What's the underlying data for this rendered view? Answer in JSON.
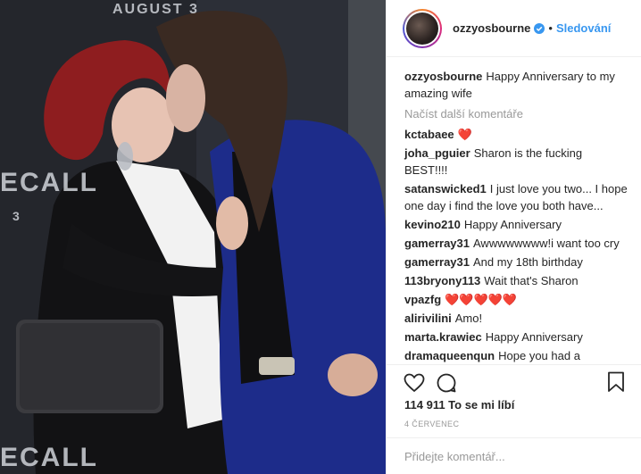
{
  "photo": {
    "backdrop_texts": [
      "AUGUST 3",
      "ECALL",
      "3",
      "ECALL"
    ],
    "image_alt": "couple kissing at premiere"
  },
  "header": {
    "username": "ozzyosbourne",
    "follow_label": "Sledování",
    "separator": "•"
  },
  "caption": {
    "user": "ozzyosbourne",
    "text": "Happy Anniversary to my amazing wife"
  },
  "load_more_label": "Načíst další komentáře",
  "comments": [
    {
      "user": "kctabaee",
      "text": "❤️"
    },
    {
      "user": "joha_pguier",
      "text": "Sharon is the fucking BEST!!!!"
    },
    {
      "user": "satanswicked1",
      "text": "I just love you two... I hope one day i find the love you both have..."
    },
    {
      "user": "kevino210",
      "text": "Happy Anniversary"
    },
    {
      "user": "gamerray31",
      "text": "Awwwwwwww!i want too cry"
    },
    {
      "user": "gamerray31",
      "text": "And my 18th birthday"
    },
    {
      "user": "113bryony113",
      "text": "Wait that's Sharon"
    },
    {
      "user": "vpazfg",
      "text": "❤️❤️❤️❤️❤️"
    },
    {
      "user": "alirivilini",
      "text": "Amo!"
    },
    {
      "user": "marta.krawiec",
      "text": "Happy Anniversary"
    },
    {
      "user": "dramaqueenqun",
      "text": "Hope you had a"
    }
  ],
  "likes_text": "114 911 To se mi líbí",
  "date_text": "4 ČERVENEC",
  "add_comment_placeholder": "Přidejte komentář...",
  "icons": {
    "heart": "heart-icon",
    "comment": "comment-bubble-icon",
    "save": "bookmark-icon",
    "verified": "verified-badge-icon"
  },
  "colors": {
    "accent": "#3897f0",
    "muted": "#999999",
    "border": "#efefef"
  }
}
